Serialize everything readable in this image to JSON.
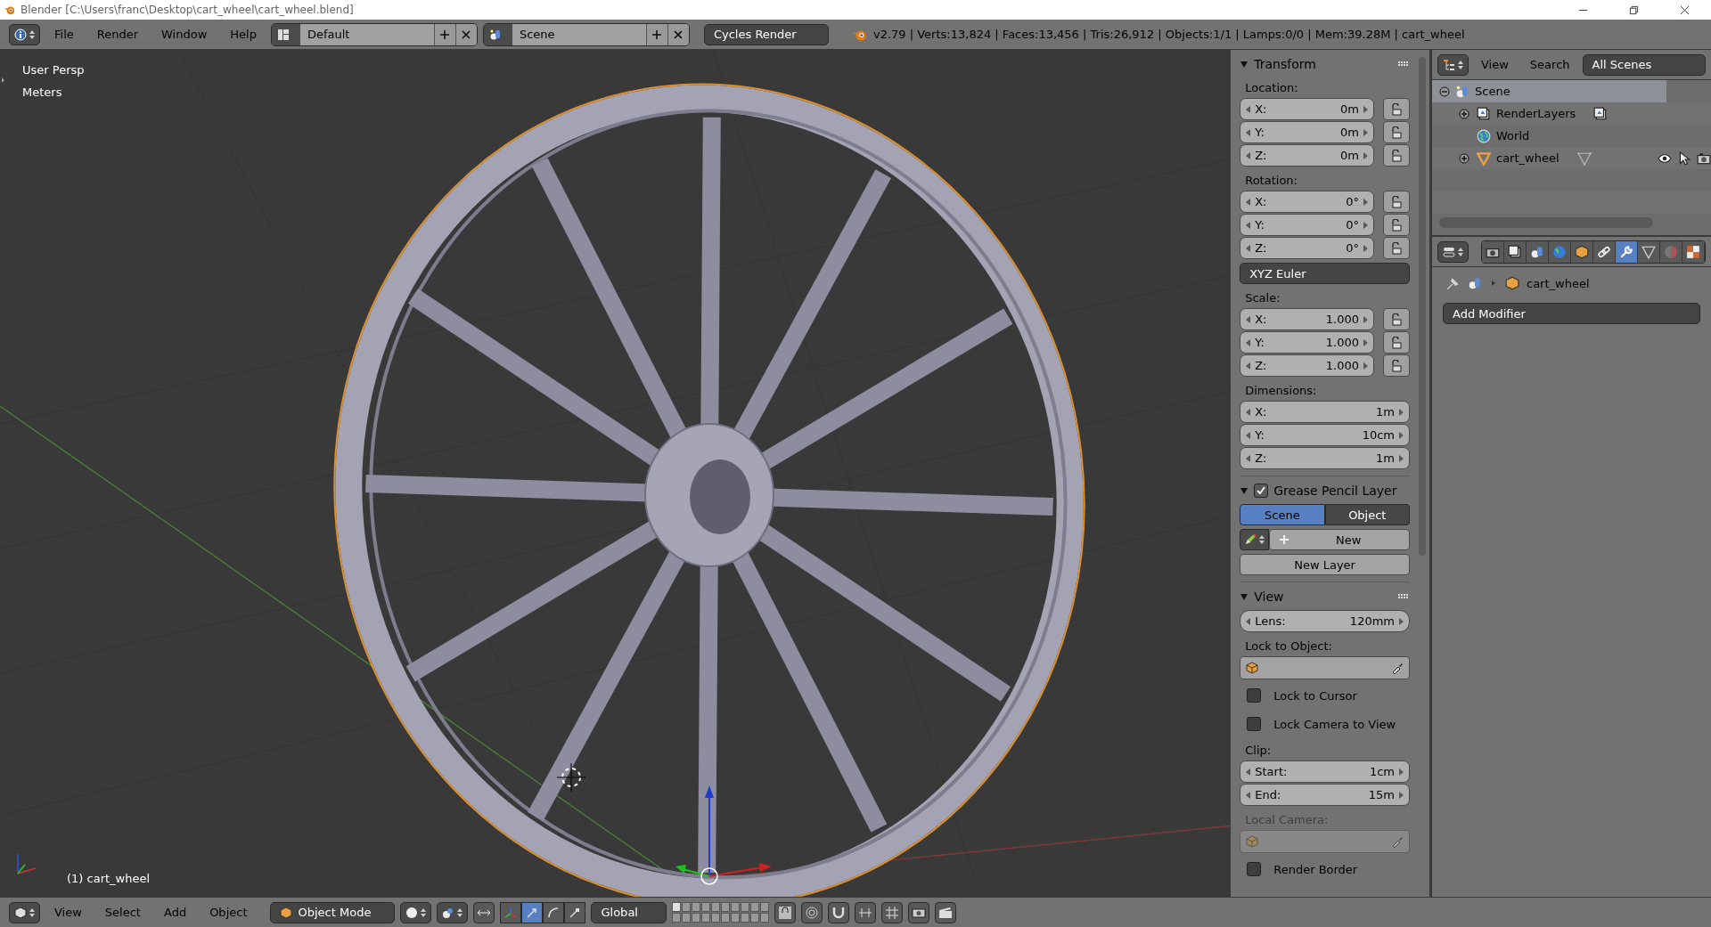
{
  "window": {
    "title": "Blender [C:\\Users\\franc\\Desktop\\cart_wheel\\cart_wheel.blend]"
  },
  "info_header": {
    "menus": [
      "File",
      "Render",
      "Window",
      "Help"
    ],
    "screen_layout": "Default",
    "scene": "Scene",
    "render_engine": "Cycles Render",
    "stats": "v2.79 | Verts:13,824 | Faces:13,456 | Tris:26,912 | Objects:1/1 | Lamps:0/0 | Mem:39.28M | cart_wheel"
  },
  "viewport": {
    "view_name": "User Persp",
    "units": "Meters",
    "object_label": "(1) cart_wheel"
  },
  "transform_panel": {
    "title": "Transform",
    "expanded": true,
    "groups": [
      {
        "kind": "lockable",
        "label": "Location:",
        "fields": [
          {
            "axis": "X:",
            "value": "0m",
            "locked": false
          },
          {
            "axis": "Y:",
            "value": "0m",
            "locked": false
          },
          {
            "axis": "Z:",
            "value": "0m",
            "locked": false
          }
        ]
      },
      {
        "kind": "lockable",
        "label": "Rotation:",
        "fields": [
          {
            "axis": "X:",
            "value": "0°",
            "locked": false
          },
          {
            "axis": "Y:",
            "value": "0°",
            "locked": false
          },
          {
            "axis": "Z:",
            "value": "0°",
            "locked": false
          }
        ]
      },
      {
        "kind": "dropdown",
        "value": "XYZ Euler"
      },
      {
        "kind": "lockable",
        "label": "Scale:",
        "fields": [
          {
            "axis": "X:",
            "value": "1.000",
            "locked": false
          },
          {
            "axis": "Y:",
            "value": "1.000",
            "locked": false
          },
          {
            "axis": "Z:",
            "value": "1.000",
            "locked": false
          }
        ]
      },
      {
        "kind": "plain",
        "label": "Dimensions:",
        "fields": [
          {
            "axis": "X:",
            "value": "1m"
          },
          {
            "axis": "Y:",
            "value": "10cm"
          },
          {
            "axis": "Z:",
            "value": "1m"
          }
        ]
      }
    ]
  },
  "grease_pencil_panel": {
    "title": "Grease Pencil Layer",
    "checked": true,
    "expanded": true,
    "sources": [
      {
        "label": "Scene",
        "selected": true
      },
      {
        "label": "Object",
        "selected": false
      }
    ],
    "new_button": "New",
    "new_layer_button": "New Layer"
  },
  "view_panel": {
    "title": "View",
    "expanded": true,
    "items": [
      {
        "kind": "slider",
        "label": "Lens:",
        "value": "120mm"
      },
      {
        "kind": "label",
        "text": "Lock to Object:",
        "disabled": false
      },
      {
        "kind": "object_field",
        "disabled": false
      },
      {
        "kind": "checkbox",
        "label": "Lock to Cursor",
        "checked": false
      },
      {
        "kind": "checkbox",
        "label": "Lock Camera to View",
        "checked": false
      },
      {
        "kind": "label",
        "text": "Clip:",
        "disabled": false
      },
      {
        "kind": "range",
        "fields": [
          {
            "label": "Start:",
            "value": "1cm"
          },
          {
            "label": "End:",
            "value": "15m"
          }
        ]
      },
      {
        "kind": "label",
        "text": "Local Camera:",
        "disabled": true
      },
      {
        "kind": "object_field",
        "disabled": true
      },
      {
        "kind": "checkbox",
        "label": "Render Border",
        "checked": false
      }
    ]
  },
  "outliner": {
    "menus": [
      "View",
      "Search"
    ],
    "display_mode": "All Scenes",
    "tree": [
      {
        "label": "Scene",
        "kind": "scene",
        "expanded": true,
        "selected": true,
        "children": [
          {
            "label": "RenderLayers",
            "kind": "renderlayers",
            "expanded": false,
            "selected": false
          },
          {
            "label": "World",
            "kind": "world",
            "selected": false
          },
          {
            "label": "cart_wheel",
            "kind": "mesh_object",
            "expanded": false,
            "selected": false
          }
        ]
      }
    ]
  },
  "properties": {
    "tabs": [
      {
        "kind": "render",
        "selected": false
      },
      {
        "kind": "render_layers",
        "selected": false
      },
      {
        "kind": "scene",
        "selected": false
      },
      {
        "kind": "world",
        "selected": false
      },
      {
        "kind": "object",
        "selected": false
      },
      {
        "kind": "constraints",
        "selected": false
      },
      {
        "kind": "modifiers",
        "selected": true
      },
      {
        "kind": "data",
        "selected": false
      },
      {
        "kind": "material",
        "selected": false
      },
      {
        "kind": "texture",
        "selected": false
      }
    ],
    "context_object": "cart_wheel",
    "add_modifier": "Add Modifier"
  },
  "viewport_header": {
    "menus": [
      "View",
      "Select",
      "Add",
      "Object"
    ],
    "mode": "Object Mode",
    "transform_orientation": "Global",
    "manipulators": [
      {
        "kind": "toggle",
        "selected": false
      },
      {
        "kind": "translate",
        "selected": true
      },
      {
        "kind": "rotate",
        "selected": false
      },
      {
        "kind": "scale",
        "selected": false
      }
    ],
    "layers": [
      {
        "selected": true
      },
      {
        "selected": false
      },
      {
        "selected": false
      },
      {
        "selected": false
      },
      {
        "selected": false
      },
      {
        "selected": false
      },
      {
        "selected": false
      },
      {
        "selected": false
      },
      {
        "selected": false
      },
      {
        "selected": false
      },
      {
        "selected": false
      },
      {
        "selected": false
      },
      {
        "selected": false
      },
      {
        "selected": false
      },
      {
        "selected": false
      },
      {
        "selected": false
      },
      {
        "selected": false
      },
      {
        "selected": false
      },
      {
        "selected": false
      },
      {
        "selected": false
      }
    ]
  }
}
